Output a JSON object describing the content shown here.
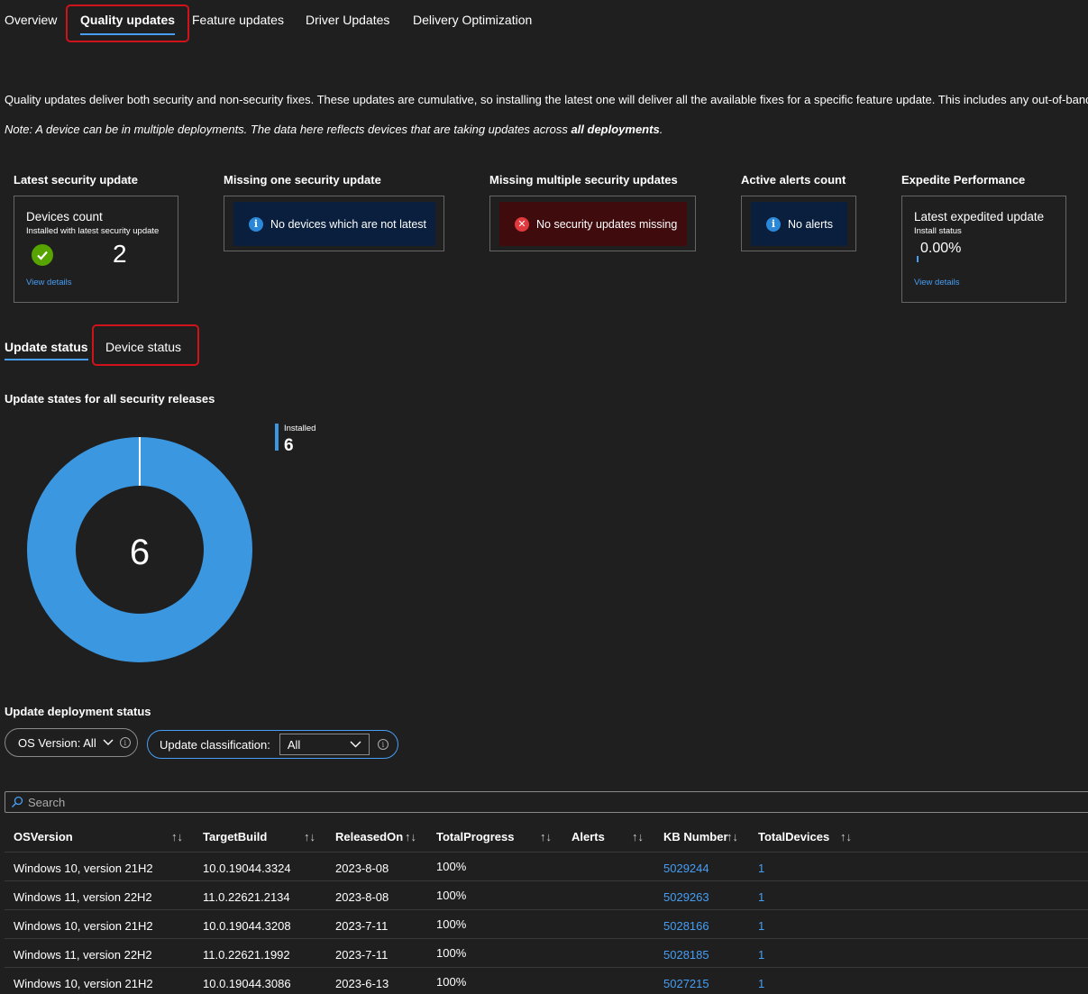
{
  "tabs": [
    "Overview",
    "Quality updates",
    "Feature updates",
    "Driver Updates",
    "Delivery Optimization"
  ],
  "description": "Quality updates deliver both security and non-security fixes. These updates are cumulative, so installing the latest one will deliver all the available fixes for a specific feature update. This includes any out-of-band",
  "note": {
    "prefix": "Note: A device can be in multiple deployments. The data here reflects devices that are taking updates across ",
    "bold": "all deployments",
    "suffix": "."
  },
  "cards": {
    "latest": {
      "title": "Latest security update",
      "label": "Devices count",
      "sublabel": "Installed with latest security update",
      "value": "2",
      "link": "View details"
    },
    "missing_one": {
      "title": "Missing one security update",
      "message": "No devices which are not latest"
    },
    "missing_multi": {
      "title": "Missing multiple security updates",
      "message": "No security updates missing"
    },
    "alerts": {
      "title": "Active alerts count",
      "message": "No alerts"
    },
    "expedite": {
      "title": "Expedite Performance",
      "label": "Latest expedited update",
      "sublabel": "Install status",
      "value": "0.00%",
      "link": "View details"
    }
  },
  "subtabs": [
    "Update status",
    "Device status"
  ],
  "chart_title": "Update states for all security releases",
  "chart_data": {
    "type": "pie",
    "categories": [
      "Installed"
    ],
    "values": [
      6
    ],
    "center_label": "6",
    "legend": [
      {
        "label": "Installed",
        "value": "6",
        "color": "#3b97e0"
      }
    ]
  },
  "deployment_title": "Update deployment status",
  "filters": {
    "os_label": "OS Version: All",
    "classification_label": "Update classification:",
    "classification_value": "All"
  },
  "search_placeholder": "Search",
  "table": {
    "columns": [
      "OSVersion",
      "TargetBuild",
      "ReleasedOn",
      "TotalProgress",
      "Alerts",
      "KB Number",
      "TotalDevices"
    ],
    "rows": [
      [
        "Windows 10, version 21H2",
        "10.0.19044.3324",
        "2023-8-08",
        "100%",
        "",
        "5029244",
        "1"
      ],
      [
        "Windows 11, version 22H2",
        "11.0.22621.2134",
        "2023-8-08",
        "100%",
        "",
        "5029263",
        "1"
      ],
      [
        "Windows 10, version 21H2",
        "10.0.19044.3208",
        "2023-7-11",
        "100%",
        "",
        "5028166",
        "1"
      ],
      [
        "Windows 11, version 22H2",
        "11.0.22621.1992",
        "2023-7-11",
        "100%",
        "",
        "5028185",
        "1"
      ],
      [
        "Windows 10, version 21H2",
        "10.0.19044.3086",
        "2023-6-13",
        "100%",
        "",
        "5027215",
        "1"
      ]
    ]
  },
  "colors": {
    "accent": "#479ef5",
    "highlight": "#d0131b",
    "donut": "#3b97e0",
    "success": "#57a300"
  }
}
